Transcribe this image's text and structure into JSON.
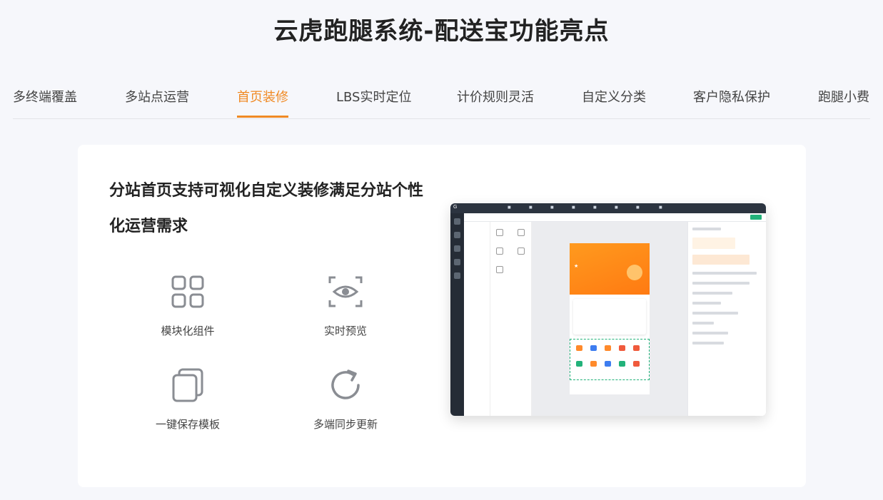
{
  "header": {
    "title": "云虎跑腿系统-配送宝功能亮点"
  },
  "tabs": [
    {
      "label": "多终端覆盖"
    },
    {
      "label": "多站点运营"
    },
    {
      "label": "首页装修",
      "active": true
    },
    {
      "label": "LBS实时定位"
    },
    {
      "label": "计价规则灵活"
    },
    {
      "label": "自定义分类"
    },
    {
      "label": "客户隐私保护"
    },
    {
      "label": "跑腿小费"
    }
  ],
  "panel": {
    "headline": "分站首页支持可视化自定义装修满足分站个性化运营需求",
    "features": [
      {
        "label": "模块化组件",
        "icon": "grid-icon"
      },
      {
        "label": "实时预览",
        "icon": "eye-scan-icon"
      },
      {
        "label": "一键保存模板",
        "icon": "stacked-pages-icon"
      },
      {
        "label": "多端同步更新",
        "icon": "refresh-icon"
      }
    ]
  },
  "colors": {
    "accent": "#f08a24",
    "icon_gray": "#8a8d93",
    "admin_green": "#22b27a",
    "admin_dark": "#2c3440"
  }
}
